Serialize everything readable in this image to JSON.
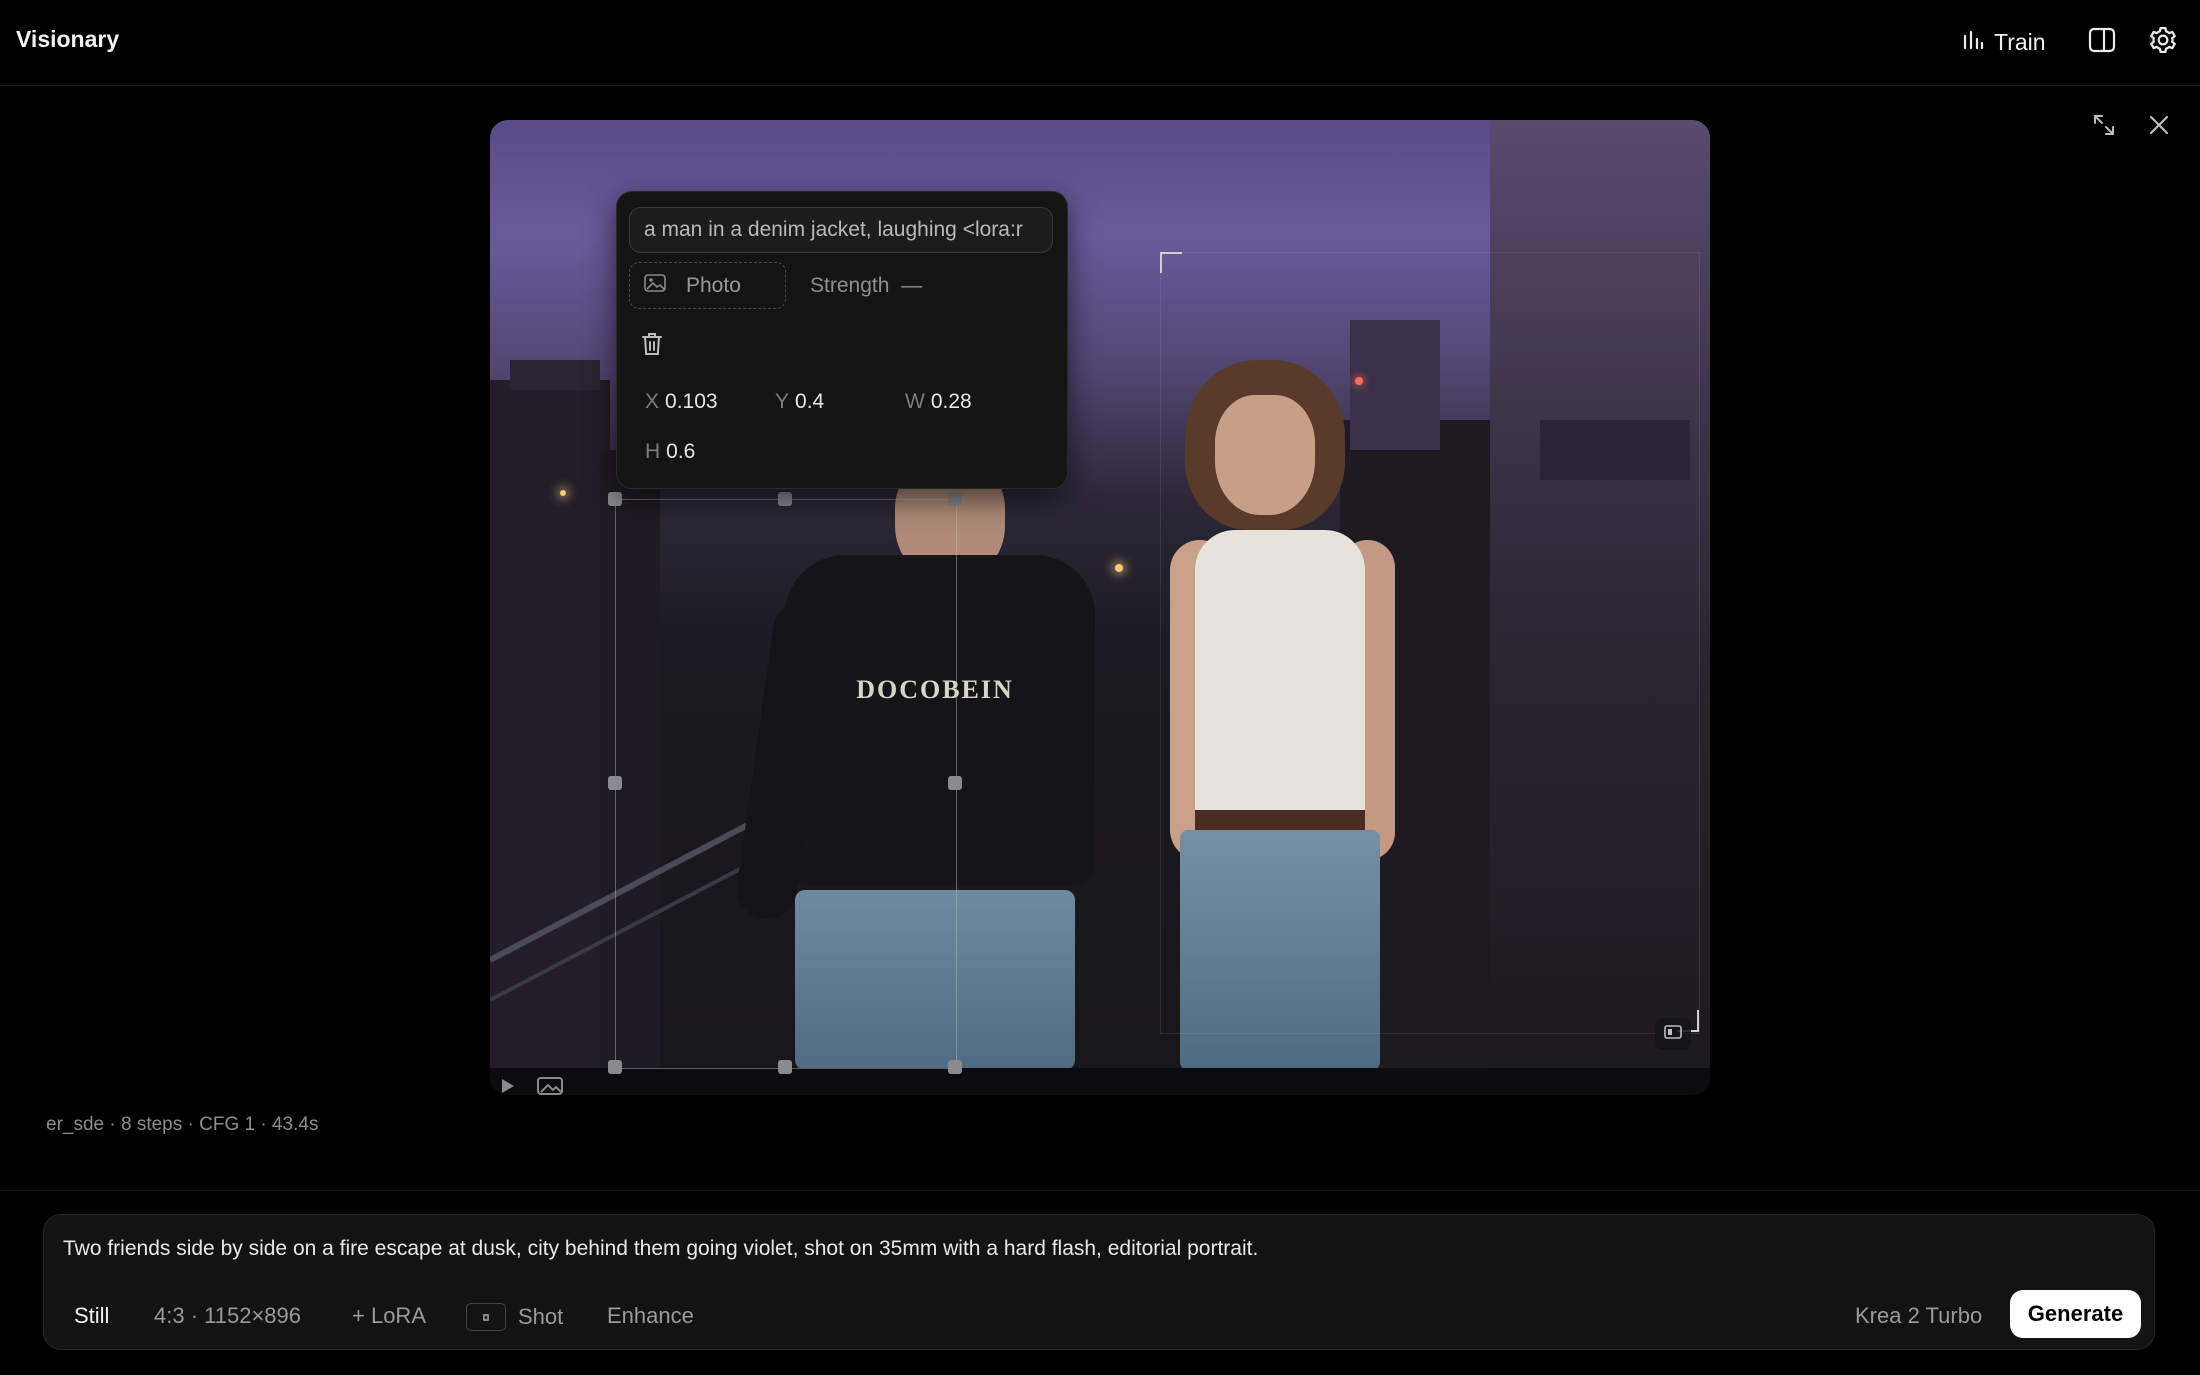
{
  "app": {
    "title": "Visionary"
  },
  "header": {
    "train_label": "Train"
  },
  "region_popover": {
    "prompt_value": "a man in a denim jacket, laughing <lora:r",
    "photo_label": "Photo",
    "strength_label": "Strength",
    "strength_value": "—",
    "x_label": "X",
    "x_value": "0.103",
    "y_label": "Y",
    "y_value": "0.4",
    "w_label": "W",
    "w_value": "0.28",
    "h_label": "H",
    "h_value": "0.6"
  },
  "image": {
    "shirt_text": "DOCOBEIN"
  },
  "generation_meta": "er_sde · 8 steps · CFG 1 · 43.4s",
  "composer": {
    "prompt": "Two friends side by side on a fire escape at dusk, city behind them going violet, shot on 35mm with a hard flash, editorial portrait.",
    "mode_label": "Still",
    "aspect_label": "4:3 · 1152×896",
    "lora_label": "+ LoRA",
    "shot_label": "Shot",
    "enhance_label": "Enhance",
    "model_label": "Krea 2 Turbo",
    "generate_label": "Generate"
  },
  "icons": [
    "bar-chart-icon",
    "sidebar-toggle-icon",
    "gear-icon",
    "expand-icon",
    "close-icon",
    "image-icon",
    "trash-icon",
    "play-icon",
    "compare-icon",
    "camera-icon"
  ]
}
